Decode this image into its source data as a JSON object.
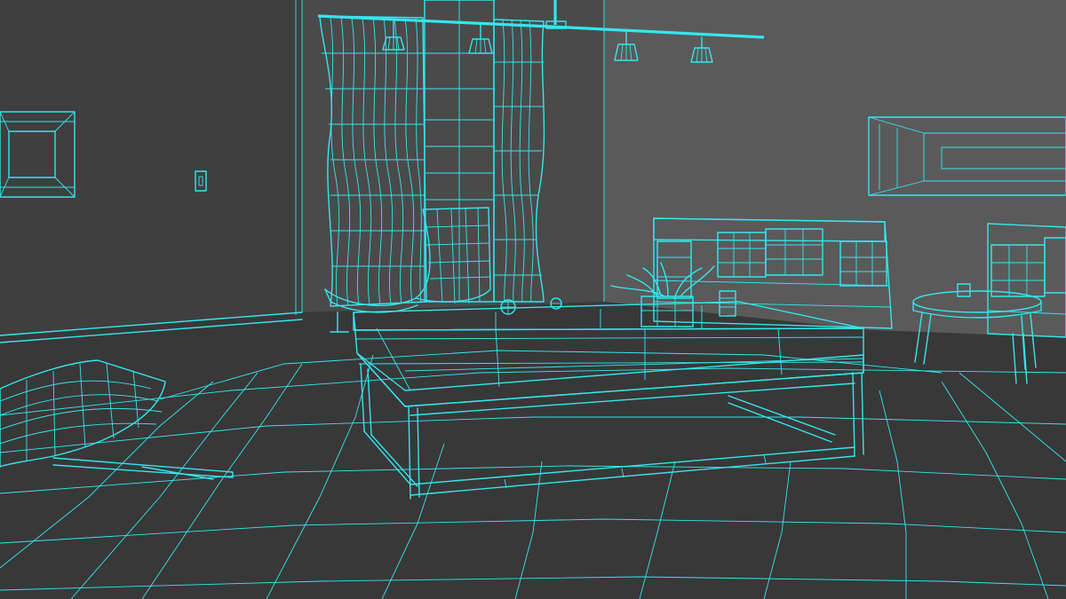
{
  "viewport": {
    "mode": "wireframe",
    "wire_color": "#35e6ee",
    "background_color": "#444444",
    "floor_color": "#3a3a3a",
    "wall_color_left": "#414141",
    "wall_color_right": "#5c5c5c"
  },
  "objects": [
    "ceiling-light-track",
    "pendant-lamp",
    "curtain-left",
    "curtain-right",
    "window-column",
    "wall-frame-left",
    "wall-frame-right",
    "light-switch",
    "lounge-chair-back",
    "lounge-chair-front",
    "coffee-table",
    "planter",
    "cup",
    "sphere-ornament",
    "sofa",
    "side-table",
    "armchair-right",
    "floor-tiles"
  ]
}
